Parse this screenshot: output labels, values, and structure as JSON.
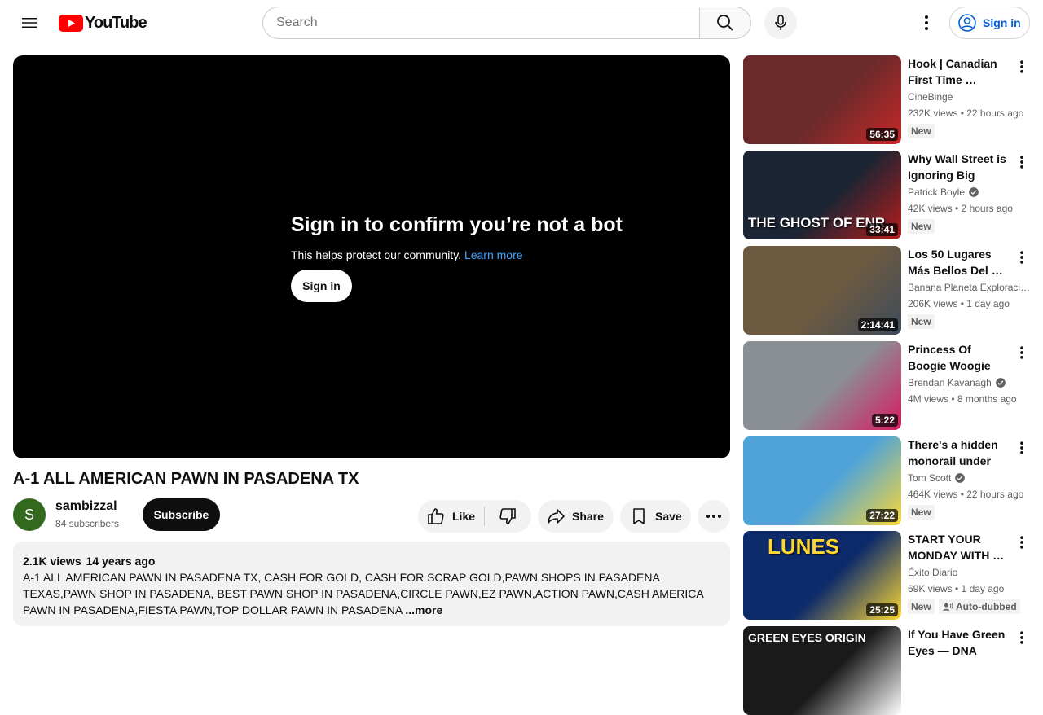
{
  "header": {
    "logo_text": "YouTube",
    "search_placeholder": "Search",
    "signin_label": "Sign in"
  },
  "player": {
    "bot_title": "Sign in to confirm you’re not a bot",
    "bot_sub": "This helps protect our community.",
    "learn_more": "Learn more",
    "signin_label": "Sign in"
  },
  "video": {
    "title": "A-1 ALL AMERICAN PAWN IN PASADENA TX",
    "channel": "sambizzal",
    "avatar_letter": "S",
    "subscribers": "84 subscribers",
    "subscribe_label": "Subscribe",
    "like_label": "Like",
    "share_label": "Share",
    "save_label": "Save",
    "views": "2.1K views",
    "age": "14 years ago",
    "description": "A-1 ALL AMERICAN PAWN IN PASADENA TX, CASH FOR GOLD, CASH FOR SCRAP GOLD,PAWN SHOPS IN PASADENA TEXAS,PAWN SHOP IN PASADENA, BEST PAWN SHOP IN PASADENA,CIRCLE PAWN,EZ PAWN,ACTION PAWN,CASH AMERICA PAWN IN PASADENA,FIESTA PAWN,TOP DOLLAR PAWN IN PASADENA",
    "more_label": "...more"
  },
  "recommendations": [
    {
      "title": "Hook | Canadian First Time …",
      "channel": "CineBinge",
      "verified": false,
      "meta": "232K views • 22 hours ago",
      "badge": "New",
      "duration": "56:35",
      "thumb_color": "#6b2a2a",
      "thumb_accent": "#c62828"
    },
    {
      "title": "Why Wall Street is Ignoring Big Tech'…",
      "channel": "Patrick Boyle",
      "verified": true,
      "meta": "42K views • 2 hours ago",
      "badge": "New",
      "duration": "33:41",
      "thumb_color": "#1b2533",
      "thumb_accent": "#b71c1c",
      "thumb_text": "THE GHOST OF ENR"
    },
    {
      "title": "Los 50 Lugares Más Bellos Del …",
      "channel": "Banana Planeta Exploraci…",
      "verified": false,
      "meta": "206K views • 1 day ago",
      "badge": "New",
      "duration": "2:14:41",
      "thumb_color": "#6d5a40",
      "thumb_accent": "#3e4c5c"
    },
    {
      "title": "Princess Of Boogie Woogie Delights …",
      "channel": "Brendan Kavanagh",
      "verified": true,
      "meta": "4M views • 8 months ago",
      "badge": "",
      "duration": "5:22",
      "thumb_color": "#8a8f96",
      "thumb_accent": "#d81b60"
    },
    {
      "title": "There's a hidden monorail under th…",
      "channel": "Tom Scott",
      "verified": true,
      "meta": "464K views • 22 hours ago",
      "badge": "New",
      "duration": "27:22",
      "thumb_color": "#4fa3d9",
      "thumb_accent": "#fdd835"
    },
    {
      "title": "START YOUR MONDAY WITH …",
      "channel": "Éxito Diario",
      "verified": false,
      "meta": "69K views • 1 day ago",
      "badge": "New",
      "badge2": "Auto-dubbed",
      "duration": "25:25",
      "thumb_color": "#0d2a6b",
      "thumb_accent": "#fdd835",
      "thumb_text": "LUNES"
    },
    {
      "title": "If You Have Green Eyes — DNA Finall…",
      "channel": "",
      "verified": false,
      "meta": "",
      "badge": "",
      "duration": "",
      "thumb_color": "#1a1a1a",
      "thumb_accent": "#ffffff",
      "thumb_text": "GREEN EYES ORIGIN"
    }
  ]
}
